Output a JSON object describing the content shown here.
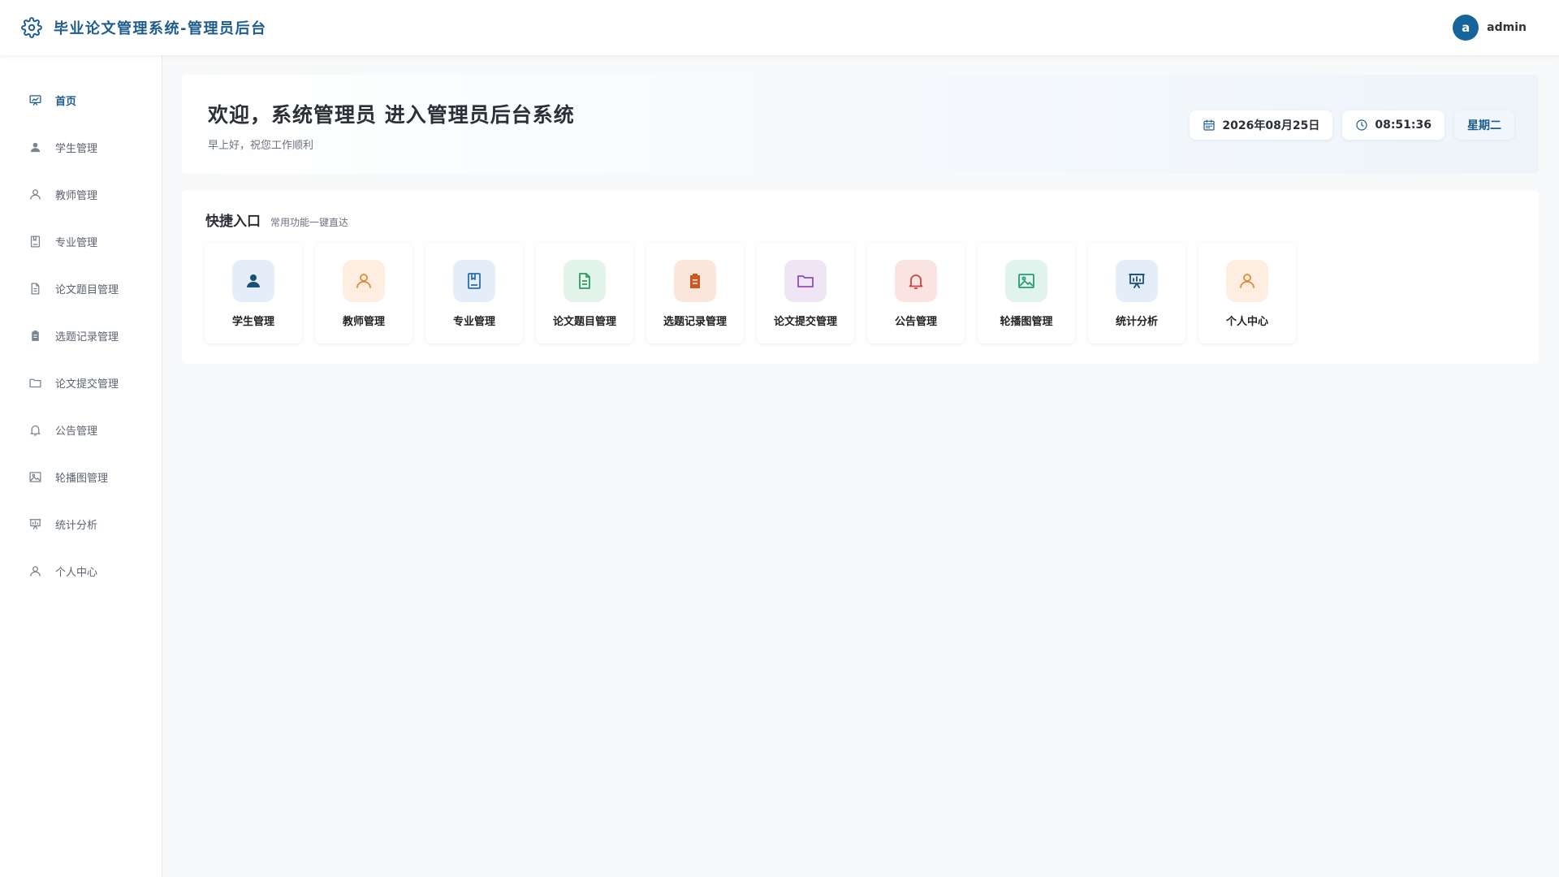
{
  "header": {
    "title": "毕业论文管理系统-管理员后台",
    "brand_icon": "gear-icon",
    "user": {
      "avatar_letter": "a",
      "name": "admin"
    }
  },
  "sidebar": {
    "items": [
      {
        "label": "首页",
        "icon": "dashboard-icon",
        "active": true
      },
      {
        "label": "学生管理",
        "icon": "user-filled-icon"
      },
      {
        "label": "教师管理",
        "icon": "user-icon"
      },
      {
        "label": "专业管理",
        "icon": "book-icon"
      },
      {
        "label": "论文题目管理",
        "icon": "document-icon"
      },
      {
        "label": "选题记录管理",
        "icon": "clipboard-icon"
      },
      {
        "label": "论文提交管理",
        "icon": "folder-icon"
      },
      {
        "label": "公告管理",
        "icon": "bell-icon"
      },
      {
        "label": "轮播图管理",
        "icon": "picture-icon"
      },
      {
        "label": "统计分析",
        "icon": "presentation-icon"
      },
      {
        "label": "个人中心",
        "icon": "user-icon"
      }
    ]
  },
  "welcome": {
    "title": "欢迎，系统管理员 进入管理员后台系统",
    "subtitle": "早上好，祝您工作顺利",
    "date": "2026年08月25日",
    "time": "08:51:36",
    "weekday": "星期二"
  },
  "quick": {
    "title": "快捷入口",
    "subtitle": "常用功能一键直达",
    "tiles": [
      {
        "label": "学生管理",
        "icon": "user-filled-icon",
        "bg": "#e3eef8",
        "fg": "#1a4f78"
      },
      {
        "label": "教师管理",
        "icon": "user-icon",
        "bg": "#fdeee0",
        "fg": "#e08a3c"
      },
      {
        "label": "专业管理",
        "icon": "book-icon",
        "bg": "#e3eef8",
        "fg": "#2a6fa8"
      },
      {
        "label": "论文题目管理",
        "icon": "document-icon",
        "bg": "#e2f4ea",
        "fg": "#2e9b5e"
      },
      {
        "label": "选题记录管理",
        "icon": "clipboard-icon",
        "bg": "#fbe6dc",
        "fg": "#d2571f"
      },
      {
        "label": "论文提交管理",
        "icon": "folder-icon",
        "bg": "#efe6f5",
        "fg": "#8e4bb5"
      },
      {
        "label": "公告管理",
        "icon": "bell-icon",
        "bg": "#fbe3e1",
        "fg": "#d0433a"
      },
      {
        "label": "轮播图管理",
        "icon": "picture-icon",
        "bg": "#e0f3ec",
        "fg": "#2a9b7a"
      },
      {
        "label": "统计分析",
        "icon": "presentation-icon",
        "bg": "#e3eef8",
        "fg": "#1a4f78"
      },
      {
        "label": "个人中心",
        "icon": "user-icon",
        "bg": "#fdeee0",
        "fg": "#e08a3c"
      }
    ]
  }
}
